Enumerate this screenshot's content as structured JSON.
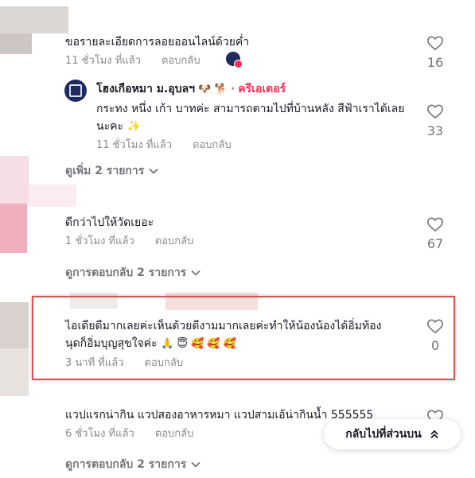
{
  "comments": [
    {
      "text": "ขอรายละเอียดการลอยออนไลน์ด้วยค่ำ",
      "time": "11 ชั่วโมง ที่แล้ว",
      "reply_label": "ตอบกลับ",
      "likes": "16"
    },
    {
      "author": "โฮงเกือหมา ม.อุบลฯ",
      "author_emojis": "🐶 🐕",
      "creator_label": "ครีเอเตอร์",
      "separator": "·",
      "text": "กระทง หนึ่ง เก้า บาทค่ะ สามารถตามไปที่บ้านหลัง สีฟ้าเราได้เลยนะคะ",
      "text_emoji": "✨",
      "time": "11 ชั่วโมง ที่แล้ว",
      "reply_label": "ตอบกลับ",
      "likes": "33"
    },
    {
      "text": "ดีกว่าไปให้วัดเยอะ",
      "time": "1 ชั่วโมง ที่แล้ว",
      "reply_label": "ตอบกลับ",
      "likes": "67"
    },
    {
      "text": "ไอเดียดีมากเลยค่ะเห็นด้วยดีงามมากเลยค่ะทำให้น้องน้องได้อิ่มท้อง",
      "text2": "นุดก็อิ่มบุญสุขใจค่ะ",
      "text2_emojis": "🙏 😇 🥰 🥰 🥰",
      "time": "3 นาที ที่แล้ว",
      "reply_label": "ตอบกลับ",
      "likes": "0"
    },
    {
      "text": "แวปแรกน่ากิน แวปสองอาหารหมา แวปสามเอ้น่ากินน้ำ 555555",
      "time": "6 ชั่วโมง ที่แล้ว",
      "reply_label": "ตอบกลับ"
    }
  ],
  "view_more": "ดูเพิ่ม 2 รายการ",
  "view_replies_1": "ดูการตอบกลับ 2 รายการ",
  "view_replies_2": "ดูการตอบกลับ 2 รายการ",
  "back_to_top": "กลับไปที่ส่วนบน",
  "colors": {
    "creator": "#fe2c55",
    "highlight_border": "#d9534f",
    "muted": "#8a8b91"
  }
}
